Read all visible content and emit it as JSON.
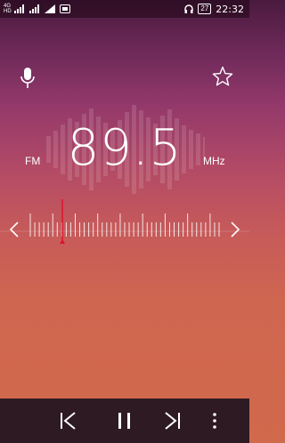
{
  "status_bar": {
    "network_label_top": "4G",
    "network_label_bottom": "HD",
    "battery": "27",
    "time": "22:32"
  },
  "radio": {
    "frequency": "89.5",
    "band": "FM",
    "unit": "MHz",
    "tuner_position": 0.17
  },
  "icons": {
    "voice": "microphone-icon",
    "favorite": "star-icon",
    "seek_back": "chevron-left-icon",
    "seek_forward": "chevron-right-icon",
    "previous": "skip-previous-icon",
    "pause": "pause-icon",
    "next": "skip-next-icon",
    "more": "more-vertical-icon"
  },
  "colors": {
    "tuner_needle": "#e0102a",
    "control_bar": "#2e1a22"
  }
}
